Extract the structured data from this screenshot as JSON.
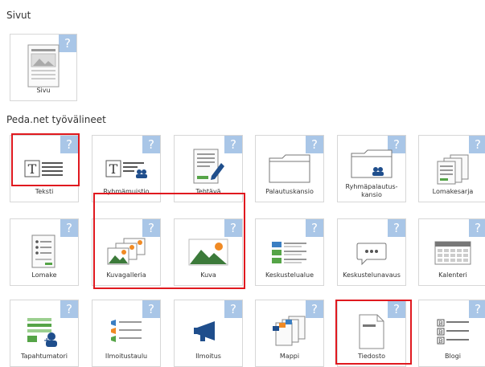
{
  "sections": {
    "pages_title": "Sivut",
    "tools_title": "Peda.net työvälineet"
  },
  "help_symbol": "?",
  "tiles": {
    "sivu": "Sivu",
    "teksti": "Teksti",
    "ryhmamuistio": "Ryhmämuistio",
    "tehtava": "Tehtävä",
    "palautuskansio": "Palautuskansio",
    "ryhmapalautuskansio": "Ryhmäpalautus-kansio",
    "lomakesarja": "Lomakesarja",
    "lomake": "Lomake",
    "kuvagalleria": "Kuvagalleria",
    "kuva": "Kuva",
    "keskustelualue": "Keskustelualue",
    "keskustelunavaus": "Keskustelunavaus",
    "kalenteri": "Kalenteri",
    "tapahtumatori": "Tapahtumatori",
    "ilmoitustaulu": "Ilmoitustaulu",
    "ilmoitus": "Ilmoitus",
    "mappi": "Mappi",
    "tiedosto": "Tiedosto",
    "blogi": "Blogi"
  },
  "colors": {
    "help_badge": "#a9c6e7",
    "highlight": "#e0191f",
    "accent_green": "#55a447",
    "accent_orange": "#f08a24"
  }
}
